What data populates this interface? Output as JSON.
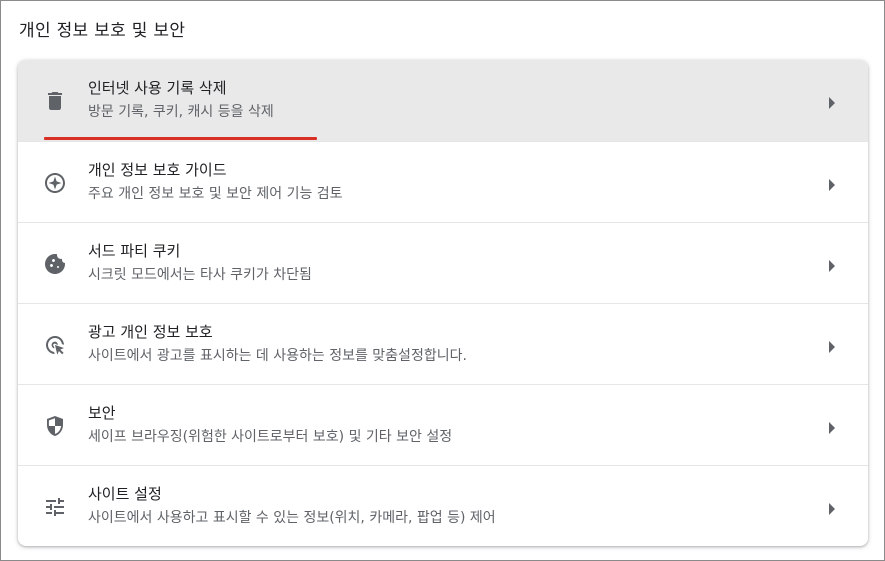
{
  "section": {
    "title": "개인 정보 보호 및 보안"
  },
  "items": [
    {
      "title": "인터넷 사용 기록 삭제",
      "subtitle": "방문 기록, 쿠키, 캐시 등을 삭제",
      "icon": "trash-icon",
      "active": true
    },
    {
      "title": "개인 정보 보호 가이드",
      "subtitle": "주요 개인 정보 보호 및 보안 제어 기능 검토",
      "icon": "compass-icon",
      "active": false
    },
    {
      "title": "서드 파티 쿠키",
      "subtitle": "시크릿 모드에서는 타사 쿠키가 차단됨",
      "icon": "cookie-icon",
      "active": false
    },
    {
      "title": "광고 개인 정보 보호",
      "subtitle": "사이트에서 광고를 표시하는 데 사용하는 정보를 맞춤설정합니다.",
      "icon": "ad-privacy-icon",
      "active": false
    },
    {
      "title": "보안",
      "subtitle": "세이프 브라우징(위험한 사이트로부터 보호) 및 기타 보안 설정",
      "icon": "shield-icon",
      "active": false
    },
    {
      "title": "사이트 설정",
      "subtitle": "사이트에서 사용하고 표시할 수 있는 정보(위치, 카메라, 팝업 등) 제어",
      "icon": "tune-icon",
      "active": false
    }
  ],
  "colors": {
    "highlight_underline": "#d93025",
    "active_row_bg": "#e9e9e9",
    "icon": "#5f6368"
  }
}
